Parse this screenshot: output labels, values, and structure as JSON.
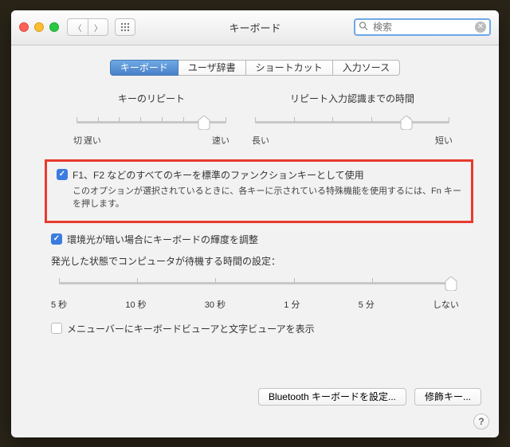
{
  "window": {
    "title": "キーボード"
  },
  "search": {
    "placeholder": "検索"
  },
  "tabs": {
    "items": [
      "キーボード",
      "ユーザ辞書",
      "ショートカット",
      "入力ソース"
    ],
    "active_index": 0
  },
  "sliders": {
    "key_repeat": {
      "title": "キーのリピート",
      "left": "切",
      "near_left": "遅い",
      "right": "速い",
      "ticks": 8,
      "value_index": 6
    },
    "delay": {
      "title": "リピート入力認識までの時間",
      "left": "長い",
      "right": "短い",
      "ticks": 6,
      "value_index": 4
    }
  },
  "fn_keys": {
    "checked": true,
    "label": "F1、F2 などのすべてのキーを標準のファンクションキーとして使用",
    "description": "このオプションが選択されているときに、各キーに示されている特殊機能を使用するには、Fn キーを押します。"
  },
  "brightness": {
    "checked": true,
    "label": "環境光が暗い場合にキーボードの輝度を調整"
  },
  "idle": {
    "label": "発光した状態でコンピュータが待機する時間の設定：",
    "ticks": [
      "5 秒",
      "10 秒",
      "30 秒",
      "1 分",
      "5 分",
      "しない"
    ],
    "value_index": 5
  },
  "menubar": {
    "checked": false,
    "label": "メニューバーにキーボードビューアと文字ビューアを表示"
  },
  "buttons": {
    "bluetooth": "Bluetooth キーボードを設定...",
    "modifier": "修飾キー..."
  }
}
